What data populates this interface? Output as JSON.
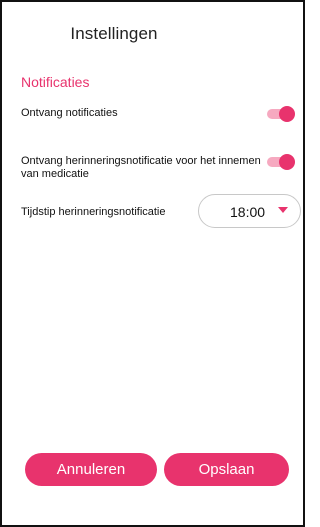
{
  "header": {
    "title": "Instellingen"
  },
  "notifications": {
    "section_title": "Notificaties",
    "receive_label": "Ontvang notificaties",
    "receive_enabled": true,
    "reminder_label": "Ontvang herinneringsnotificatie voor het innemen van medicatie",
    "reminder_enabled": true,
    "time_label": "Tijdstip herinneringsnotificatie",
    "time_value": "18:00",
    "time_caret_icon": "caret-down-icon"
  },
  "actions": {
    "cancel_label": "Annuleren",
    "save_label": "Opslaan"
  },
  "colors": {
    "accent": "#e8336d",
    "accent_light": "#f6a9c0"
  }
}
